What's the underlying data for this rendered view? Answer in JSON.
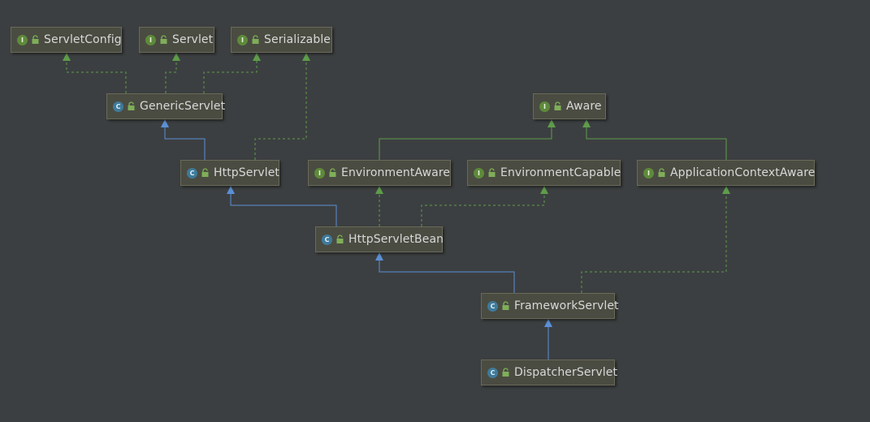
{
  "diagram": {
    "nodes": [
      {
        "id": "servletconfig",
        "label": "ServletConfig",
        "kind": "interface",
        "badge": "I"
      },
      {
        "id": "servlet",
        "label": "Servlet",
        "kind": "interface",
        "badge": "I"
      },
      {
        "id": "serializable",
        "label": "Serializable",
        "kind": "interface",
        "badge": "I"
      },
      {
        "id": "genericservlet",
        "label": "GenericServlet",
        "kind": "class",
        "badge": "C"
      },
      {
        "id": "aware",
        "label": "Aware",
        "kind": "interface",
        "badge": "I"
      },
      {
        "id": "httpservlet",
        "label": "HttpServlet",
        "kind": "class",
        "badge": "C"
      },
      {
        "id": "environmentaware",
        "label": "EnvironmentAware",
        "kind": "interface",
        "badge": "I"
      },
      {
        "id": "environmentcapable",
        "label": "EnvironmentCapable",
        "kind": "interface",
        "badge": "I"
      },
      {
        "id": "applicationcontextaware",
        "label": "ApplicationContextAware",
        "kind": "interface",
        "badge": "I"
      },
      {
        "id": "httpservletbean",
        "label": "HttpServletBean",
        "kind": "class",
        "badge": "C"
      },
      {
        "id": "frameworkservlet",
        "label": "FrameworkServlet",
        "kind": "class",
        "badge": "C"
      },
      {
        "id": "dispatcherservlet",
        "label": "DispatcherServlet",
        "kind": "class",
        "badge": "C"
      }
    ],
    "edges": [
      {
        "from": "genericservlet",
        "to": "servletconfig",
        "type": "implements"
      },
      {
        "from": "genericservlet",
        "to": "servlet",
        "type": "implements"
      },
      {
        "from": "genericservlet",
        "to": "serializable",
        "type": "implements"
      },
      {
        "from": "httpservlet",
        "to": "genericservlet",
        "type": "extends"
      },
      {
        "from": "httpservlet",
        "to": "serializable",
        "type": "implements"
      },
      {
        "from": "environmentaware",
        "to": "aware",
        "type": "extends-interface"
      },
      {
        "from": "applicationcontextaware",
        "to": "aware",
        "type": "extends-interface"
      },
      {
        "from": "httpservletbean",
        "to": "httpservlet",
        "type": "extends"
      },
      {
        "from": "httpservletbean",
        "to": "environmentaware",
        "type": "implements"
      },
      {
        "from": "httpservletbean",
        "to": "environmentcapable",
        "type": "implements"
      },
      {
        "from": "frameworkservlet",
        "to": "httpservletbean",
        "type": "extends"
      },
      {
        "from": "frameworkservlet",
        "to": "applicationcontextaware",
        "type": "implements"
      },
      {
        "from": "dispatcherservlet",
        "to": "frameworkservlet",
        "type": "extends"
      }
    ],
    "colors": {
      "extends": "#5b8fd6",
      "implements": "#5e9c4a",
      "extends-interface": "#5e9c4a"
    }
  }
}
